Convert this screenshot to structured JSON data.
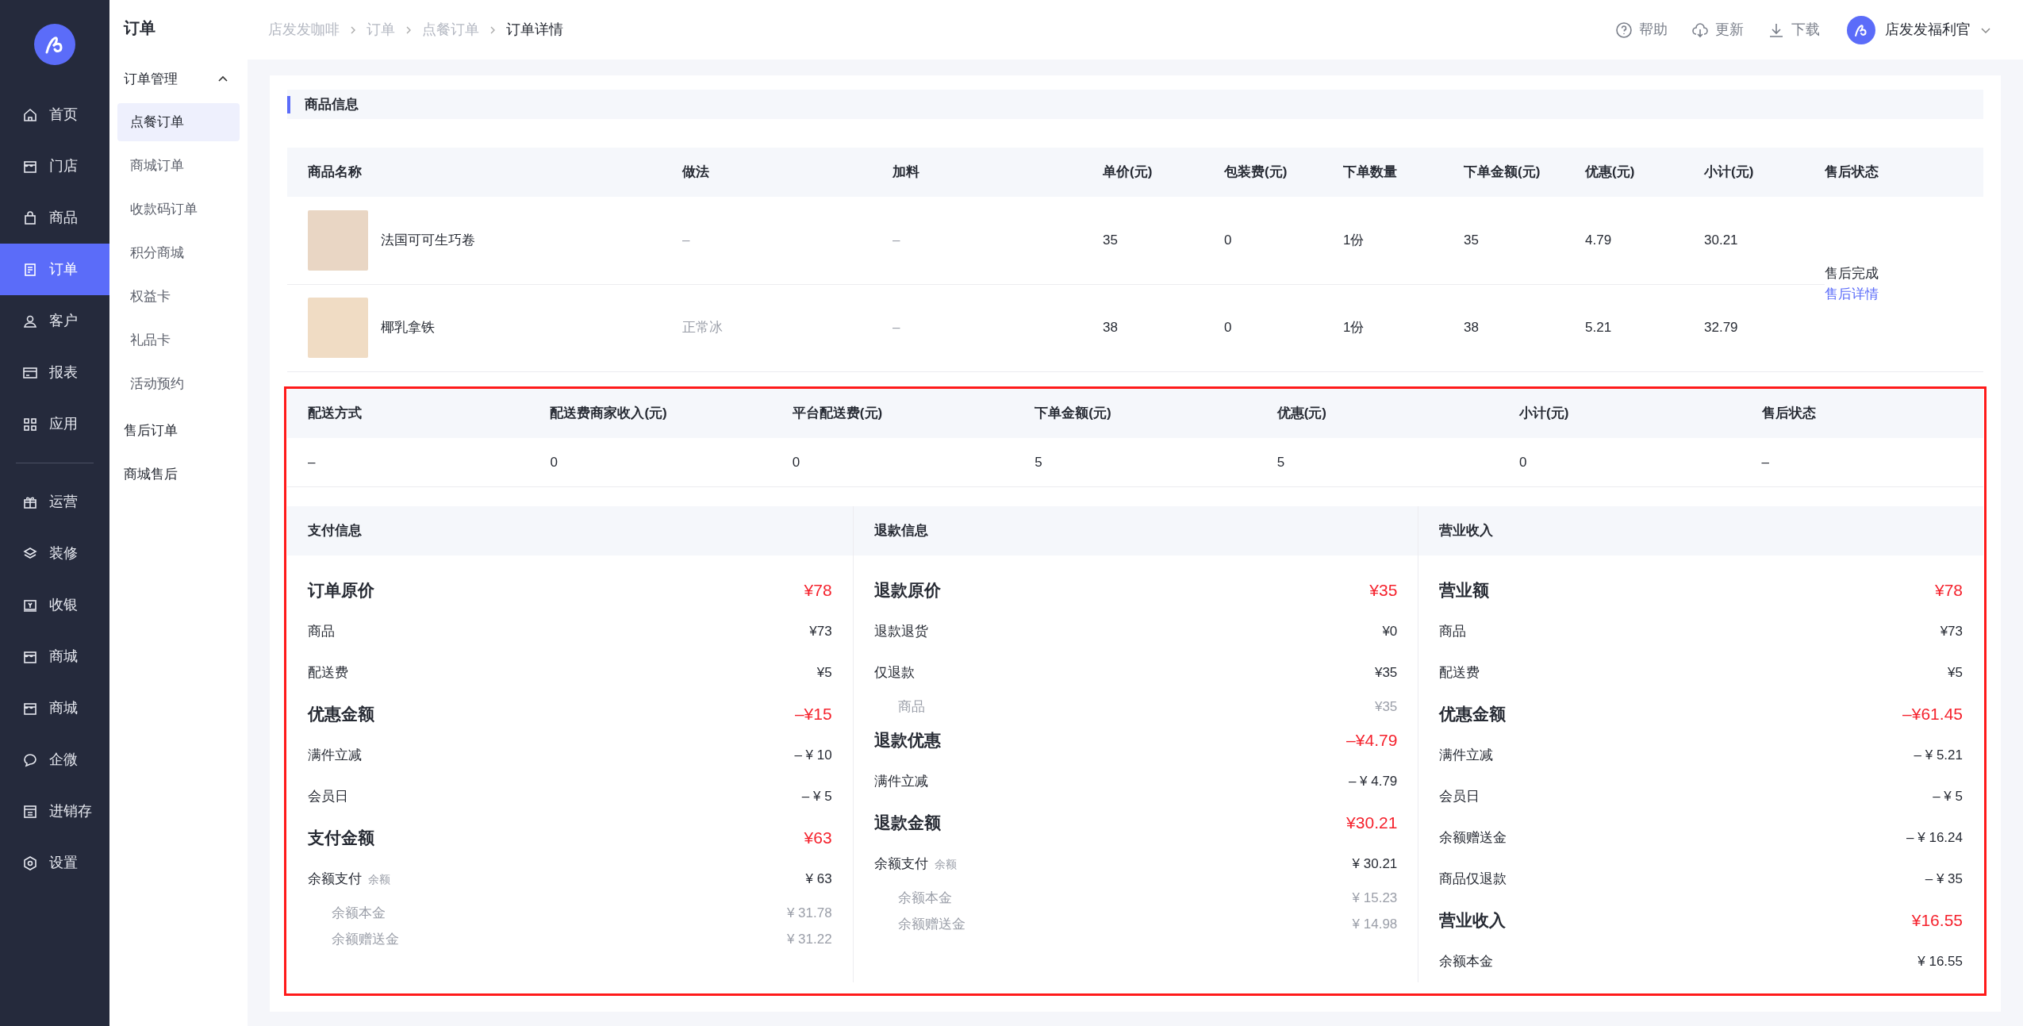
{
  "sidebar": {
    "primary_items": [
      {
        "label": "首页",
        "selected": false
      },
      {
        "label": "门店",
        "selected": false
      },
      {
        "label": "商品",
        "selected": false
      },
      {
        "label": "订单",
        "selected": true
      },
      {
        "label": "客户",
        "selected": false
      },
      {
        "label": "报表",
        "selected": false
      },
      {
        "label": "应用",
        "selected": false
      }
    ],
    "secondary_items": [
      {
        "label": "运营",
        "selected": false
      },
      {
        "label": "装修",
        "selected": false
      },
      {
        "label": "收银",
        "selected": false
      },
      {
        "label": "商城",
        "selected": false
      },
      {
        "label": "商城",
        "selected": false
      },
      {
        "label": "企微",
        "selected": false
      },
      {
        "label": "进销存",
        "selected": false
      },
      {
        "label": "设置",
        "selected": false
      }
    ]
  },
  "subnav": {
    "title": "订单",
    "items": [
      {
        "kind": "group",
        "label": "订单管理",
        "expanded": true,
        "children": [
          {
            "label": "点餐订单",
            "selected": true
          },
          {
            "label": "商城订单",
            "selected": false
          },
          {
            "label": "收款码订单",
            "selected": false
          },
          {
            "label": "积分商城",
            "selected": false
          },
          {
            "label": "权益卡",
            "selected": false
          },
          {
            "label": "礼品卡",
            "selected": false
          },
          {
            "label": "活动预约",
            "selected": false
          }
        ]
      },
      {
        "kind": "link",
        "label": "售后订单"
      },
      {
        "kind": "link",
        "label": "商城售后"
      }
    ]
  },
  "breadcrumb": [
    "店发发咖啡",
    "订单",
    "点餐订单",
    "订单详情"
  ],
  "toolbar": [
    {
      "label": "帮助"
    },
    {
      "label": "更新"
    },
    {
      "label": "下载"
    }
  ],
  "user": {
    "name": "店发发福利官"
  },
  "product_section": {
    "title": "商品信息",
    "columns": [
      "商品名称",
      "做法",
      "加料",
      "单价(元)",
      "包装费(元)",
      "下单数量",
      "下单金额(元)",
      "优惠(元)",
      "小计(元)",
      "售后状态"
    ],
    "rows": [
      [
        "法国可可生巧卷",
        "–",
        "–",
        "35",
        "0",
        "1份",
        "35",
        "4.79",
        "30.21"
      ],
      [
        "椰乳拿铁",
        "正常冰",
        "–",
        "38",
        "0",
        "1份",
        "38",
        "5.21",
        "32.79"
      ]
    ],
    "after_sale": {
      "status": "售后完成",
      "link": "售后详情"
    }
  },
  "delivery": {
    "columns": [
      "配送方式",
      "配送费商家收入(元)",
      "平台配送费(元)",
      "下单金额(元)",
      "优惠(元)",
      "小计(元)",
      "售后状态"
    ],
    "rows": [
      [
        "–",
        "0",
        "0",
        "5",
        "5",
        "0",
        "–"
      ]
    ]
  },
  "panels": [
    {
      "title": "支付信息",
      "lines": [
        {
          "kind": "heading",
          "label": "订单原价",
          "value": "¥78"
        },
        {
          "kind": "item",
          "label": "商品",
          "value": "¥73"
        },
        {
          "kind": "item",
          "label": "配送费",
          "value": "¥5"
        },
        {
          "kind": "heading",
          "label": "优惠金额",
          "value": "–¥15"
        },
        {
          "kind": "item",
          "label": "满件立减",
          "value": "– ¥ 10"
        },
        {
          "kind": "item",
          "label": "会员日",
          "value": "– ¥ 5"
        },
        {
          "kind": "heading",
          "label": "支付金额",
          "value": "¥63"
        },
        {
          "kind": "item",
          "label": "余额支付",
          "note": "余额",
          "value": "¥ 63"
        },
        {
          "kind": "sub",
          "label": "余额本金",
          "value": "¥ 31.78"
        },
        {
          "kind": "sub",
          "label": "余额赠送金",
          "value": "¥ 31.22"
        }
      ]
    },
    {
      "title": "退款信息",
      "lines": [
        {
          "kind": "heading",
          "label": "退款原价",
          "value": "¥35"
        },
        {
          "kind": "item",
          "label": "退款退货",
          "value": "¥0"
        },
        {
          "kind": "item",
          "label": "仅退款",
          "value": "¥35"
        },
        {
          "kind": "sub",
          "label": "商品",
          "value": "¥35"
        },
        {
          "kind": "heading",
          "label": "退款优惠",
          "value": "–¥4.79"
        },
        {
          "kind": "item",
          "label": "满件立减",
          "value": "– ¥ 4.79"
        },
        {
          "kind": "heading",
          "label": "退款金额",
          "value": "¥30.21"
        },
        {
          "kind": "item",
          "label": "余额支付",
          "note": "余额",
          "value": "¥ 30.21"
        },
        {
          "kind": "sub",
          "label": "余额本金",
          "value": "¥ 15.23"
        },
        {
          "kind": "sub",
          "label": "余额赠送金",
          "value": "¥ 14.98"
        }
      ]
    },
    {
      "title": "营业收入",
      "lines": [
        {
          "kind": "heading",
          "label": "营业额",
          "value": "¥78"
        },
        {
          "kind": "item",
          "label": "商品",
          "value": "¥73"
        },
        {
          "kind": "item",
          "label": "配送费",
          "value": "¥5"
        },
        {
          "kind": "heading",
          "label": "优惠金额",
          "value": "–¥61.45"
        },
        {
          "kind": "item",
          "label": "满件立减",
          "value": "– ¥ 5.21"
        },
        {
          "kind": "item",
          "label": "会员日",
          "value": "– ¥ 5"
        },
        {
          "kind": "item",
          "label": "余额赠送金",
          "value": "– ¥ 16.24"
        },
        {
          "kind": "item",
          "label": "商品仅退款",
          "value": "– ¥ 35"
        },
        {
          "kind": "heading",
          "label": "营业收入",
          "value": "¥16.55"
        },
        {
          "kind": "item",
          "label": "余额本金",
          "value": "¥ 16.55"
        }
      ]
    }
  ]
}
